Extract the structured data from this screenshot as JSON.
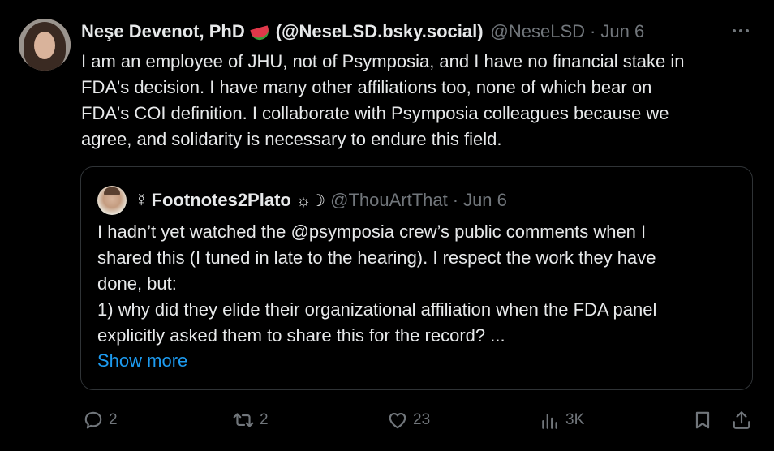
{
  "tweet": {
    "author": {
      "display_name": "Neşe Devenot, PhD",
      "bluesky": "(@NeseLSD.bsky.social)",
      "handle": "@NeseLSD",
      "separator": "·",
      "date": "Jun 6"
    },
    "more_icon": "more-horizontal-icon",
    "body_lines": [
      "I am an employee of JHU, not of Psymposia, and I have no financial stake in",
      "FDA's decision. I have many other affiliations too, none of which bear on",
      "FDA's COI definition. I collaborate with Psymposia colleagues because we",
      "agree, and solidarity is necessary to endure this field."
    ],
    "quote": {
      "glyph": "☿",
      "display_name": "Footnotes2Plato",
      "sun_glyph": "☼☽",
      "handle": "@ThouArtThat",
      "separator": "·",
      "date": "Jun 6",
      "body_lines": [
        "I hadn’t yet watched the @psymposia crew’s public comments when I",
        "shared this (I tuned in late to the hearing). I respect the work they have",
        "done, but:",
        "1) why did they elide their organizational affiliation when the FDA panel",
        "explicitly asked them to share this for the record? ..."
      ],
      "show_more": "Show more"
    },
    "actions": {
      "replies": "2",
      "reposts": "2",
      "likes": "23",
      "views": "3K"
    }
  },
  "colors": {
    "background": "#000000",
    "text": "#e7e9ea",
    "muted": "#71767b",
    "link": "#1d9bf0",
    "border": "#2f3336"
  }
}
